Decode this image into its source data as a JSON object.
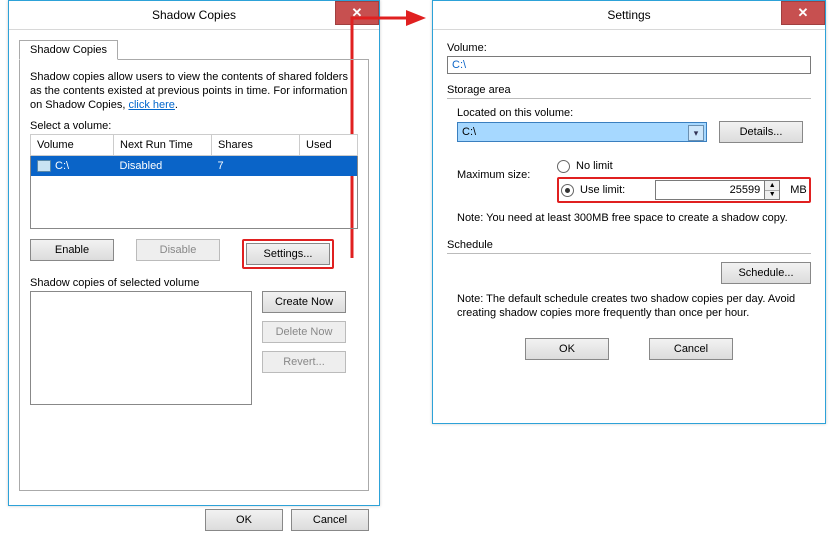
{
  "dialog1": {
    "title": "Shadow Copies",
    "tab_label": "Shadow Copies",
    "description_pre": "Shadow copies allow users to view the contents of shared folders as the contents existed at previous points in time. For information on Shadow Copies, ",
    "description_link": "click here",
    "description_post": ".",
    "select_label": "Select a volume:",
    "columns": {
      "c1": "Volume",
      "c2": "Next Run Time",
      "c3": "Shares",
      "c4": "Used"
    },
    "row": {
      "volume": "C:\\",
      "next_run": "Disabled",
      "shares": "7",
      "used": ""
    },
    "btn_enable": "Enable",
    "btn_disable": "Disable",
    "btn_settings": "Settings...",
    "selected_label": "Shadow copies of selected volume",
    "btn_create": "Create Now",
    "btn_delete": "Delete Now",
    "btn_revert": "Revert...",
    "ok": "OK",
    "cancel": "Cancel"
  },
  "dialog2": {
    "title": "Settings",
    "volume_label": "Volume:",
    "volume_value": "C:\\",
    "storage_label": "Storage area",
    "located_label": "Located on this volume:",
    "located_value": "C:\\",
    "btn_details": "Details...",
    "max_label": "Maximum size:",
    "radio_nolimit": "No limit",
    "radio_uselimit": "Use limit:",
    "limit_value": "25599",
    "limit_unit": "MB",
    "note1": "Note: You need at least 300MB free space to create a shadow copy.",
    "schedule_label": "Schedule",
    "btn_schedule": "Schedule...",
    "note2": "Note: The default schedule creates two shadow copies per day. Avoid creating shadow copies more frequently than once per hour.",
    "ok": "OK",
    "cancel": "Cancel"
  }
}
